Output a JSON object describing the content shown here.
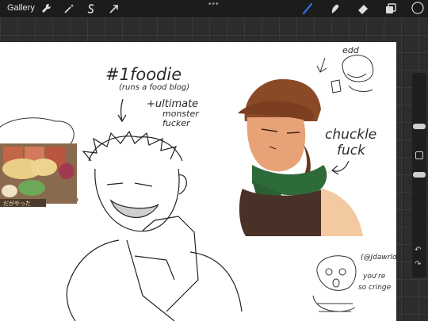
{
  "toolbar": {
    "gallery_label": "Gallery",
    "more_dots": "•••",
    "tools_left": [
      "wrench-icon",
      "magic-wand-icon",
      "selection-s-icon",
      "transform-arrow-icon"
    ],
    "tools_right": [
      "brush-icon",
      "smudge-icon",
      "eraser-icon",
      "layers-icon",
      "color-swatch"
    ],
    "active_color": "#1a1a1a",
    "brush_accent": "#2f6fe0"
  },
  "canvas": {
    "annotations": {
      "foodie_title": "#1foodie",
      "foodie_sub": "(runs a food blog)",
      "ultimate": "+ultimate",
      "monster": "monster",
      "fucker": "fucker",
      "edd": "edd",
      "chuckle": "chuckle",
      "fuck": "fuck",
      "handle": "(@Jdawrld)",
      "youre": "you're",
      "so_cringe": "so cringe"
    },
    "photo_caption": "だがやった"
  },
  "sidebar": {
    "undo_icon": "undo-icon",
    "redo_icon": "redo-icon",
    "undo_glyph": "↶",
    "redo_glyph": "↷"
  }
}
